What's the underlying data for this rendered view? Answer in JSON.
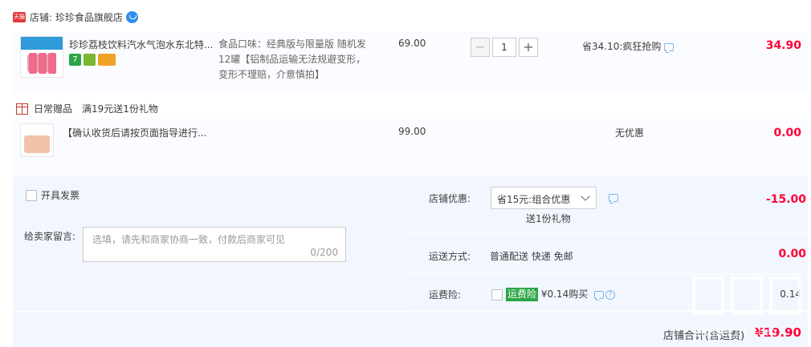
{
  "shop": {
    "badge": "天猫",
    "name": "店铺: 珍珍食品旗舰店"
  },
  "items": [
    {
      "title": "珍珍荔枝饮料汽水气泡水东北特...",
      "badges": [
        "7",
        "",
        ""
      ],
      "spec": "食品口味：经典版与限量版 随机发 12罐【铝制品运输无法规避变形，变形不理赔，介意慎拍】",
      "price": "69.00",
      "quantity": "1",
      "discount": "省34.10:疯狂抢购",
      "subtotal": "34.90"
    },
    {
      "title": "【确认收货后请按页面指导进行...",
      "price": "99.00",
      "discount": "无优惠",
      "subtotal": "0.00"
    }
  ],
  "gift": {
    "type": "日常赠品",
    "promo": "满19元送1份礼物"
  },
  "invoice": {
    "label": "开具发票"
  },
  "message": {
    "label": "给卖家留言:",
    "placeholder": "选填，请先和商家协商一致，付款后商家可见",
    "count": "0/200"
  },
  "promo": {
    "label": "店铺优惠:",
    "selected": "省15元:组合优惠",
    "sub": "送1份礼物",
    "value": "-15.00"
  },
  "shipping": {
    "label": "运送方式:",
    "method": "普通配送 快递 免邮",
    "value": "0.00"
  },
  "insurance": {
    "label": "运费险:",
    "tag": "运费险",
    "price": "¥0.14购买",
    "value": "0.14"
  },
  "total": {
    "label": "店铺合计(含运费)",
    "value": "¥19.90"
  },
  "watermark": {
    "text": "zhidezhi.com"
  },
  "colors": {
    "price_red": "#ff0036",
    "panel_bg": "#f2f7ff",
    "insurance_green": "#2aa545"
  }
}
